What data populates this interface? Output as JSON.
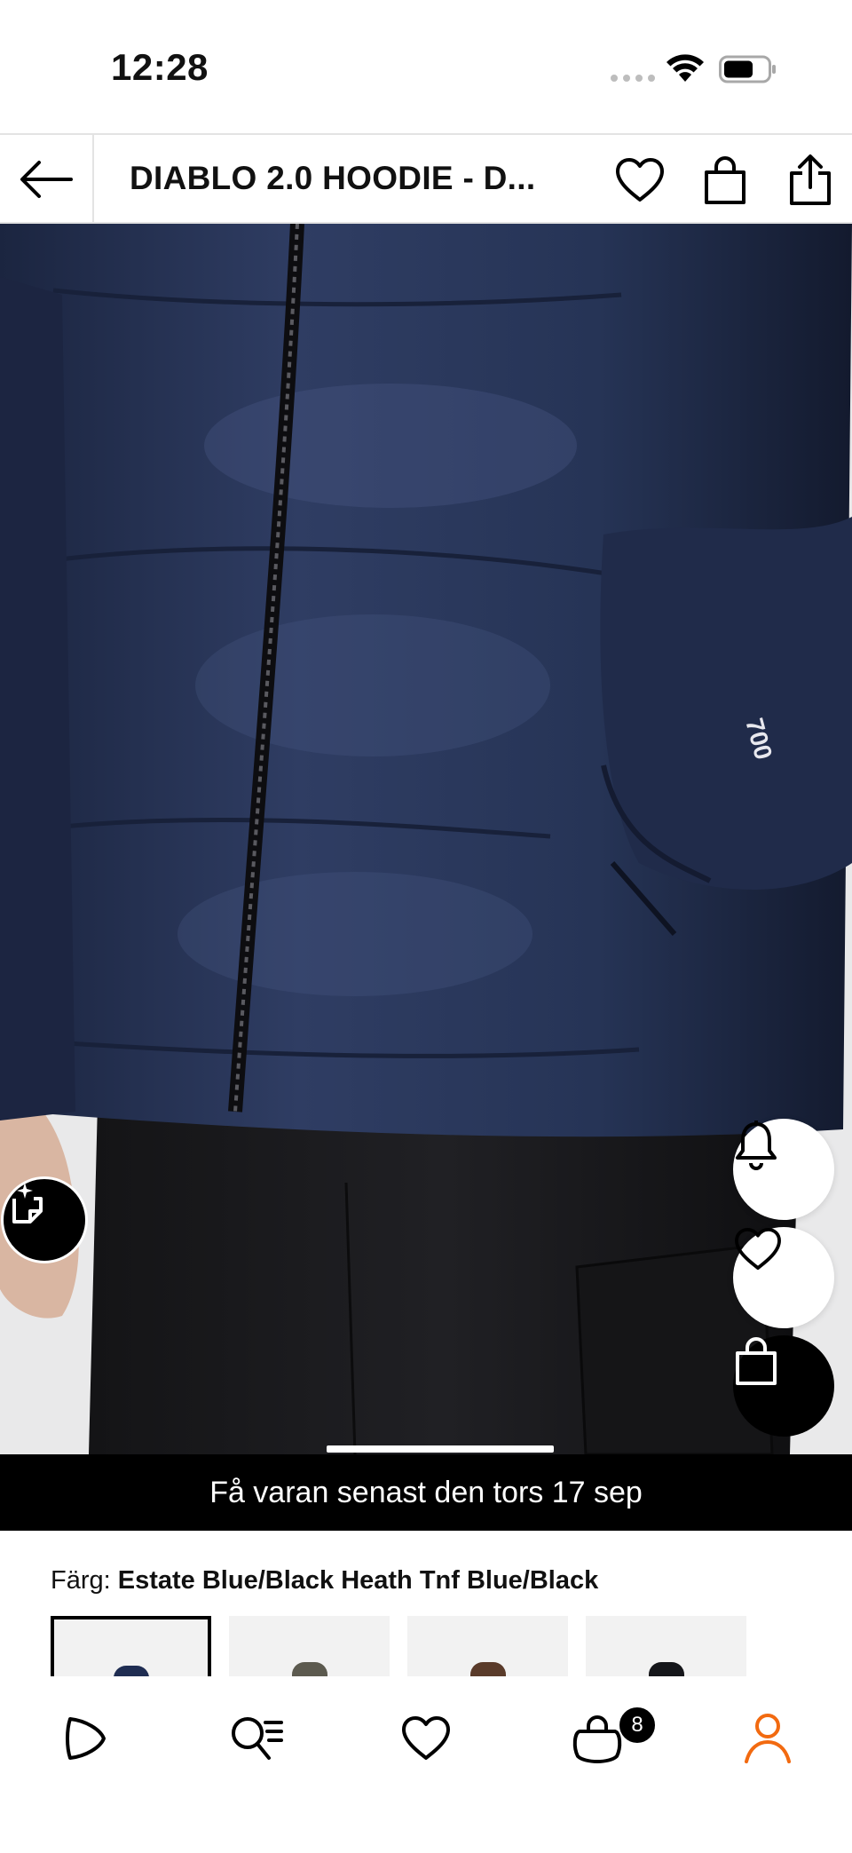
{
  "status_bar": {
    "time": "12:28",
    "icons": [
      "signal-dots-icon",
      "wifi-icon",
      "battery-icon"
    ]
  },
  "header": {
    "title": "DIABLO 2.0 HOODIE - D...",
    "icons": [
      "back-arrow-icon",
      "heart-icon",
      "bag-icon",
      "share-icon"
    ]
  },
  "product_image": {
    "jacket_color": "#26334f",
    "pants_color": "#1a1a1c",
    "background_color": "#e9e9ea",
    "sleeve_print": "700",
    "active_slide_fraction": 0.2667
  },
  "floating_actions": [
    "bell-icon",
    "heart-icon",
    "bag-icon",
    "ai-search-icon"
  ],
  "delivery_banner": {
    "text": "Få varan senast den tors 17 sep"
  },
  "color_selection": {
    "label": "Färg:",
    "value": "Estate Blue/Black Heath Tnf Blue/Black",
    "swatches": [
      {
        "color": "#1f2d52",
        "selected": true
      },
      {
        "color": "#5c5a4f",
        "selected": false
      },
      {
        "color": "#5a3b2a",
        "selected": false
      },
      {
        "color": "#15161a",
        "selected": false
      }
    ]
  },
  "bottom_nav": {
    "items": [
      "play-icon",
      "search-list-icon",
      "heart-icon",
      "cart-icon",
      "profile-icon"
    ],
    "cart_count": "8",
    "active_color": "#f26a10"
  }
}
